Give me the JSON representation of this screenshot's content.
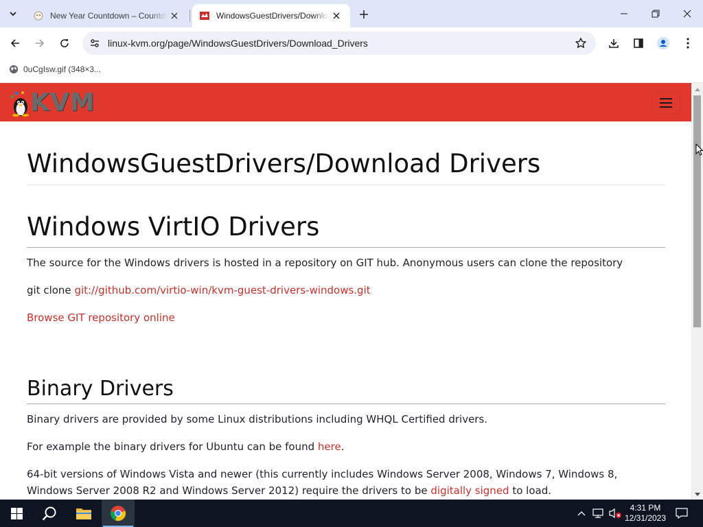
{
  "browser": {
    "tabs": [
      {
        "title": "New Year Countdown – Countdown to New Year",
        "active": false
      },
      {
        "title": "WindowsGuestDrivers/Download_Drivers",
        "active": true
      }
    ],
    "address": "linux-kvm.org/page/WindowsGuestDrivers/Download_Drivers",
    "bookmarks": [
      {
        "label": "0uCgIsw.gif (348×3..."
      }
    ]
  },
  "site": {
    "logo_text": "KVM",
    "page_title": "WindowsGuestDrivers/Download Drivers",
    "sections": [
      {
        "heading": "Windows VirtIO Drivers",
        "intro": "The source for the Windows drivers is hosted in a repository on GIT hub. Anonymous users can clone the repository",
        "git_prefix": "git clone ",
        "git_link": "git://github.com/virtio-win/kvm-guest-drivers-windows.git",
        "browse_link": "Browse GIT repository online"
      },
      {
        "heading": "Binary Drivers",
        "p1": "Binary drivers are provided by some Linux distributions including WHQL Certified drivers.",
        "p2_prefix": "For example the binary drivers for Ubuntu can be found ",
        "p2_link": "here",
        "p2_suffix": ".",
        "p3_prefix": "64-bit versions of Windows Vista and newer (this currently includes Windows Server 2008, Windows 7, Windows 8, Windows Server 2008 R2 and Windows Server 2012) require the drivers to be ",
        "p3_link": "digitally signed",
        "p3_suffix": " to load."
      }
    ]
  },
  "taskbar": {
    "time": "4:31 PM",
    "date": "12/31/2023"
  },
  "colors": {
    "site_header": "#e1382e",
    "link": "#c6322b",
    "tabstrip": "#dee6f7",
    "taskbar": "#0c1521"
  }
}
